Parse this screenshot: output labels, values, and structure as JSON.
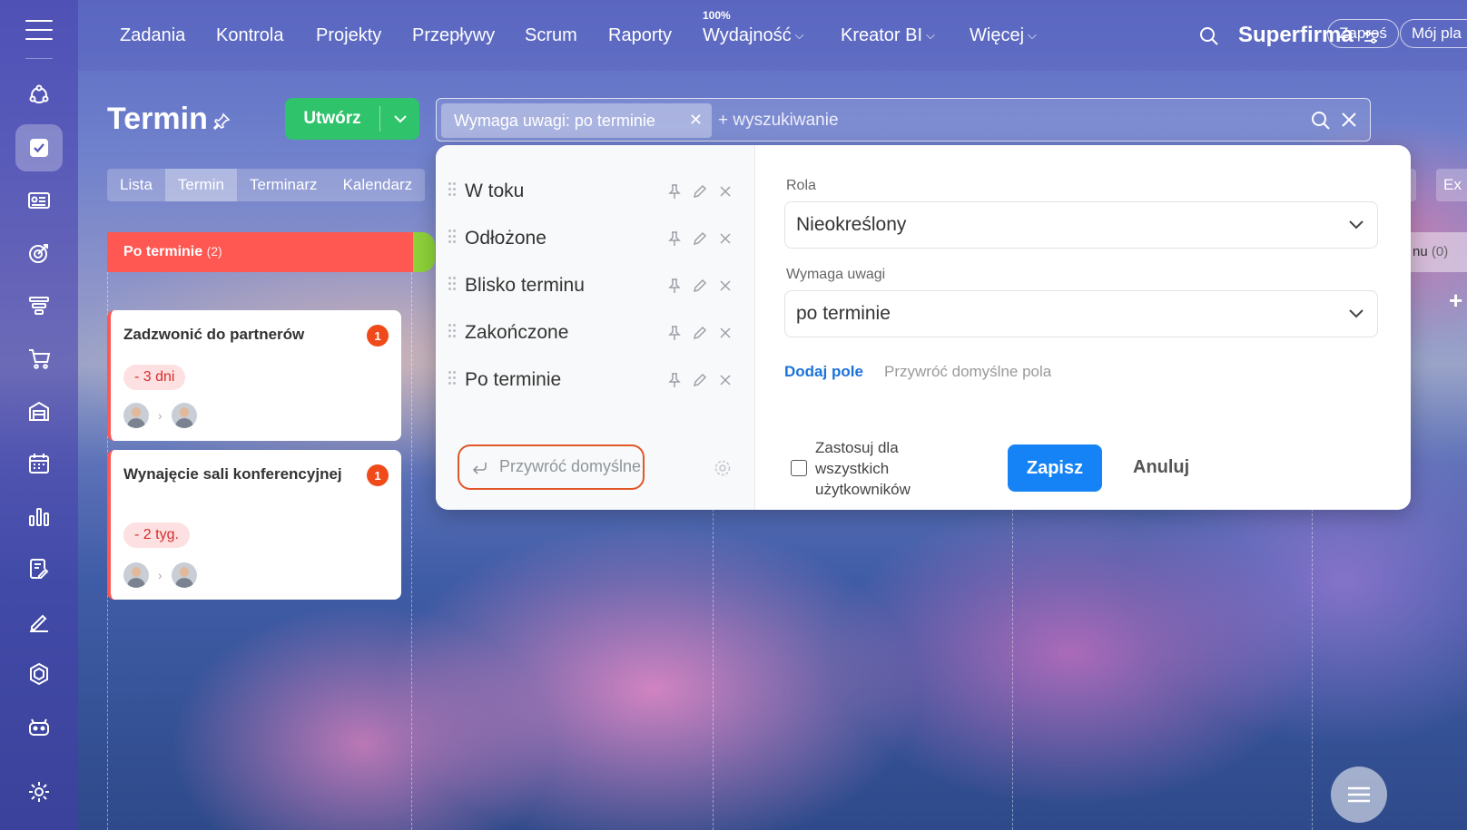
{
  "topnav": {
    "items": [
      {
        "label": "Zadania"
      },
      {
        "label": "Kontrola"
      },
      {
        "label": "Projekty"
      },
      {
        "label": "Przepływy"
      },
      {
        "label": "Scrum"
      },
      {
        "label": "Raporty"
      },
      {
        "label": "Wydajność",
        "badge": "100%"
      },
      {
        "label": "Kreator BI"
      },
      {
        "label": "Więcej"
      }
    ],
    "brand": "Superfirma",
    "invite_label": "Zaproś",
    "plan_label": "Mój pla"
  },
  "page": {
    "title": "Termin",
    "create_label": "Utwórz"
  },
  "search": {
    "filter_chip": "Wymaga uwagi: po terminie",
    "placeholder": "+ wyszukiwanie"
  },
  "tabs": [
    "Lista",
    "Termin",
    "Terminarz",
    "Kalendarz"
  ],
  "right_fragments": {
    "a": "i",
    "b": "Ex"
  },
  "kanban": {
    "column": {
      "title": "Po terminie",
      "count": "(2)"
    },
    "side_column": {
      "title": "nu",
      "count": "(0)"
    },
    "cards": [
      {
        "title": "Zadzwonić do partnerów",
        "badge": "1",
        "deadline": "- 3 dni"
      },
      {
        "title": "Wynajęcie sali konferencyjnej",
        "badge": "1",
        "deadline": "- 2 tyg."
      }
    ]
  },
  "popup": {
    "presets": [
      "W toku",
      "Odłożone",
      "Blisko terminu",
      "Zakończone",
      "Po terminie"
    ],
    "restore_default": "Przywróć domyślne",
    "fields": [
      {
        "label": "Rola",
        "value": "Nieokreślony"
      },
      {
        "label": "Wymaga uwagi",
        "value": "po terminie"
      }
    ],
    "add_field": "Dodaj pole",
    "restore_fields": "Przywróć domyślne pola",
    "apply_all": "Zastosuj dla wszystkich użytkowników",
    "save": "Zapisz",
    "cancel": "Anuluj"
  },
  "colors": {
    "accent_green": "#2fc36b",
    "overdue_red": "#ff5752",
    "primary_blue": "#1583f5",
    "highlight_orange": "#e0572a"
  }
}
